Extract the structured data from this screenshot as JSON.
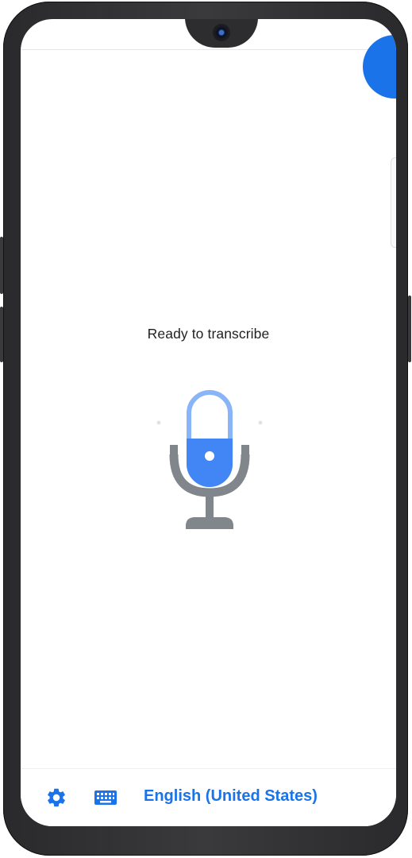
{
  "transcribe": {
    "status_text": "Ready to transcribe"
  },
  "bottom_bar": {
    "language_label": "English (United States)"
  },
  "icons": {
    "settings": "gear-icon",
    "keyboard": "keyboard-icon",
    "microphone": "microphone-icon"
  },
  "colors": {
    "accent": "#1a73e8",
    "mic_light": "#8ab4f8",
    "mic_stand": "#80868b"
  }
}
